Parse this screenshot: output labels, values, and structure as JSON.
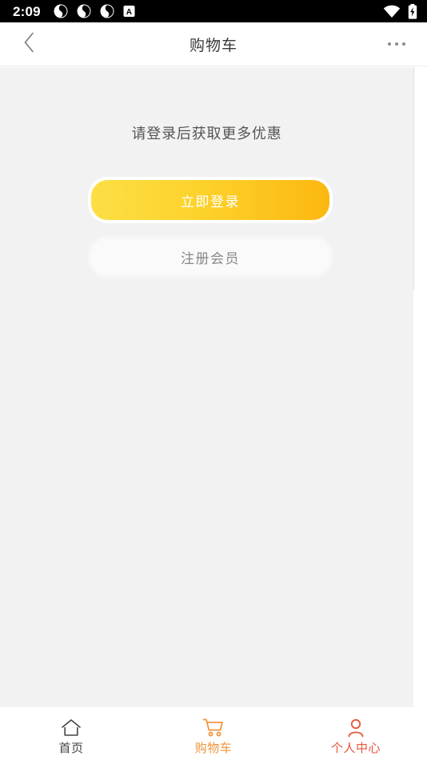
{
  "statusbar": {
    "clock": "2:09",
    "left_icons": [
      "app-badge-icon",
      "app-badge-icon",
      "app-badge-icon",
      "letter-a-badge-icon"
    ],
    "right_icons": [
      "wifi-icon",
      "battery-charging-icon"
    ]
  },
  "header": {
    "back_icon": "chevron-left-icon",
    "title": "购物车",
    "more_icon": "more-horizontal-icon"
  },
  "main": {
    "prompt": "请登录后获取更多优惠",
    "login_label": "立即登录",
    "register_label": "注册会员"
  },
  "tabbar": {
    "items": [
      {
        "label": "首页",
        "icon": "home-icon",
        "active": false,
        "color": "#444444"
      },
      {
        "label": "购物车",
        "icon": "cart-icon",
        "active": true,
        "color": "#f0943c"
      },
      {
        "label": "个人中心",
        "icon": "person-icon",
        "active": false,
        "color": "#e8563a"
      }
    ]
  },
  "colors": {
    "status_bg": "#000000",
    "content_bg": "#f2f2f2",
    "login_gradient_start": "#fcdf45",
    "login_gradient_end": "#fcb810",
    "title_text": "#3a3a3a",
    "prompt_text": "#555555",
    "register_text": "#888888"
  }
}
